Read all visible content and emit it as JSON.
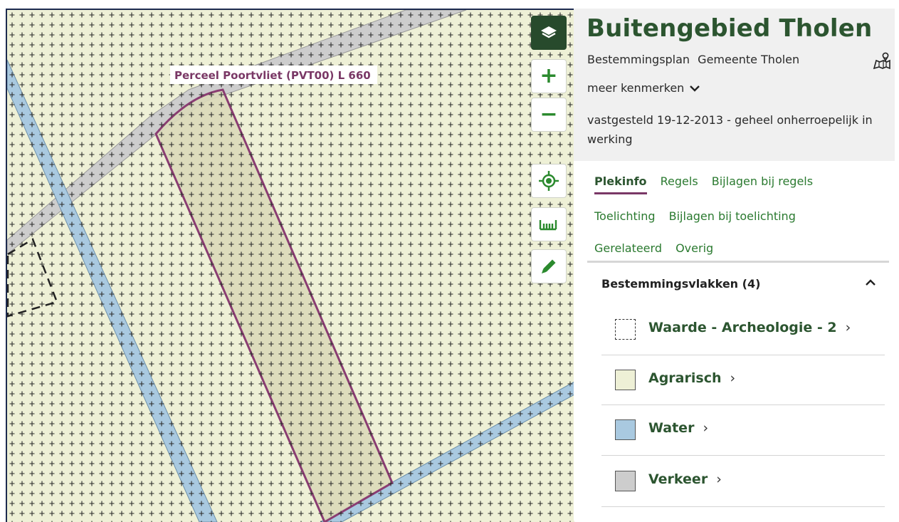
{
  "map": {
    "parcel_label": "Perceel Poortvliet (PVT00) L 660",
    "controls": {
      "layers": {
        "icon": "layers-icon"
      },
      "zoom_in": {
        "label": "+",
        "icon": "zoom-in-icon"
      },
      "zoom_out": {
        "label": "−",
        "icon": "zoom-out-icon"
      },
      "locate": {
        "icon": "locate-icon"
      },
      "measure": {
        "icon": "ruler-icon"
      },
      "draw": {
        "icon": "pencil-icon"
      }
    },
    "colors": {
      "agrarisch": "#eef0d6",
      "water": "#a9c9e0",
      "verkeer": "#cdcdcd",
      "parcel_outline": "#8a3d72",
      "controls_accent": "#2b8a2e"
    }
  },
  "panel": {
    "title": "Buitengebied Tholen",
    "subtitle": {
      "type": "Bestemmingsplan",
      "authority": "Gemeente Tholen"
    },
    "more_label": "meer kenmerken",
    "status": "vastgesteld 19-12-2013 - geheel onherroepelijk in werking",
    "tabs": [
      "Plekinfo",
      "Regels",
      "Bijlagen bij regels",
      "Toelichting",
      "Bijlagen bij toelichting",
      "Gerelateerd",
      "Overig"
    ],
    "active_tab": "Plekinfo",
    "section": {
      "title": "Bestemmingsvlakken (4)",
      "items": [
        {
          "label": "Waarde - Archeologie - 2",
          "swatch": "dashed",
          "color": "#ffffff"
        },
        {
          "label": "Agrarisch",
          "swatch": "solid",
          "color": "#eef0d6"
        },
        {
          "label": "Water",
          "swatch": "solid",
          "color": "#a9c9e0"
        },
        {
          "label": "Verkeer",
          "swatch": "solid",
          "color": "#cdcdcd"
        }
      ]
    }
  }
}
